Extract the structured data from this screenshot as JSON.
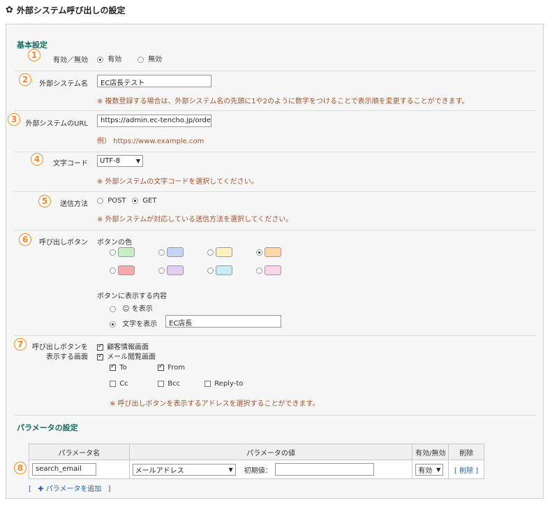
{
  "page": {
    "title": "外部システム呼び出しの設定"
  },
  "basic": {
    "title": "基本設定"
  },
  "badges": [
    "1",
    "2",
    "3",
    "4",
    "5",
    "6",
    "7",
    "8"
  ],
  "enable": {
    "label": "有効／無効",
    "options": [
      "有効",
      "無効"
    ],
    "selected": "有効"
  },
  "system_name": {
    "label": "外部システム名",
    "value": "EC店長テスト",
    "note": "※ 複数登録する場合は、外部システム名の先頭に1や2のように数字をつけることで表示順を変更することができます。"
  },
  "system_url": {
    "label": "外部システムのURL",
    "value": "https://admin.ec-tencho.jp/order",
    "note": "例） https://www.example.com"
  },
  "charset": {
    "label": "文字コード",
    "value": "UTF-8",
    "note": "※ 外部システムの文字コードを選択してください。"
  },
  "method": {
    "label": "送信方法",
    "options": [
      "POST",
      "GET"
    ],
    "selected": "GET",
    "note": "※ 外部システムが対応している送信方法を選択してください。"
  },
  "button": {
    "label": "呼び出しボタン",
    "color_title": "ボタンの色",
    "colors": [
      "#c8efc4",
      "#c4d4f4",
      "#fff3bd",
      "#fdd8a4",
      "#f6aaaa",
      "#e2ccf4",
      "#c8ecf4",
      "#fbd4ec"
    ],
    "selected_color_index": 3,
    "content_title": "ボタンに表示する内容",
    "icon_option": "☺ を表示",
    "text_option": "文字を表示",
    "text_value": "EC店長"
  },
  "display": {
    "label_line1": "呼び出しボタンを",
    "label_line2": "表示する画面",
    "screens": [
      "顧客情報画面",
      "メール閲覧画面"
    ],
    "to": "To",
    "from": "From",
    "cc": "Cc",
    "bcc": "Bcc",
    "reply_to": "Reply-to",
    "note": "※ 呼び出しボタンを表示するアドレスを選択することができます。"
  },
  "params": {
    "title": "パラメータの設定",
    "headers": [
      "パラメータ名",
      "パラメータの値",
      "有効/無効",
      "削除"
    ],
    "row": {
      "name": "search_email",
      "value": "メールアドレス",
      "initial_label": "初期値：",
      "initial_value": "",
      "enabled": "有効",
      "delete": "[ 削除 ]"
    },
    "add_open": "[",
    "add_label": "パラメータを追加",
    "add_close": "]"
  }
}
